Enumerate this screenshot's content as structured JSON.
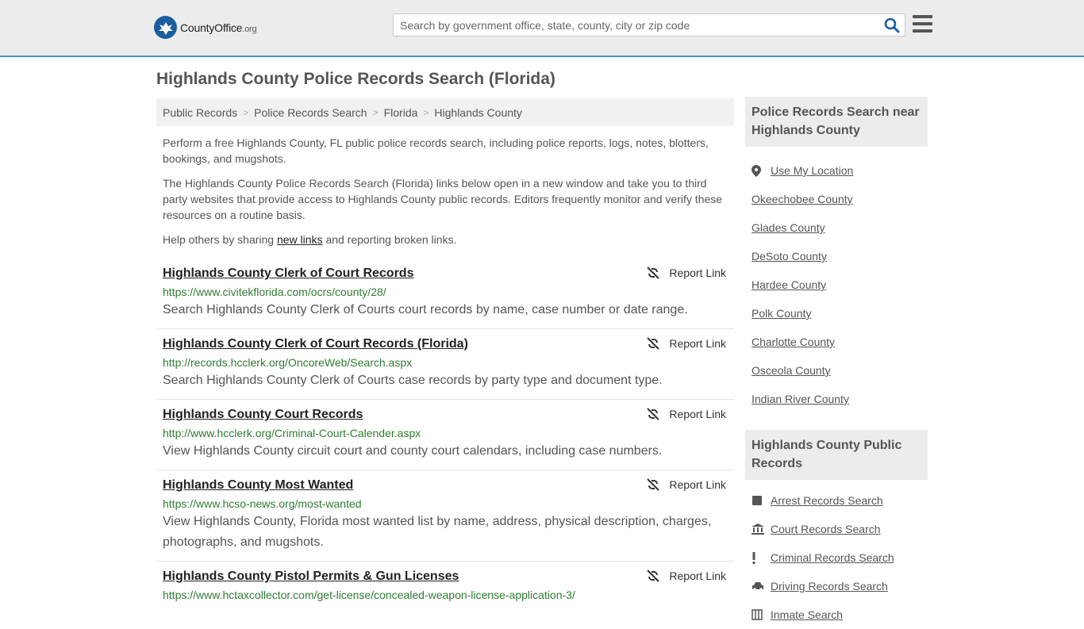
{
  "header": {
    "logo_name": "CountyOffice",
    "logo_suffix": ".org",
    "search_placeholder": "Search by government office, state, county, city or zip code"
  },
  "page_title": "Highlands County Police Records Search (Florida)",
  "breadcrumb": [
    "Public Records",
    "Police Records Search",
    "Florida",
    "Highlands County"
  ],
  "intro": {
    "p1": "Perform a free Highlands County, FL public police records search, including police reports, logs, notes, blotters, bookings, and mugshots.",
    "p2": "The Highlands County Police Records Search (Florida) links below open in a new window and take you to third party websites that provide access to Highlands County public records. Editors frequently monitor and verify these resources on a routine basis.",
    "p3_before": "Help others by sharing ",
    "p3_link": "new links",
    "p3_after": " and reporting broken links."
  },
  "report_label": "Report Link",
  "results": [
    {
      "title": "Highlands County Clerk of Court Records",
      "url": "https://www.civitekflorida.com/ocrs/county/28/",
      "desc": "Search Highlands County Clerk of Courts court records by name, case number or date range."
    },
    {
      "title": "Highlands County Clerk of Court Records (Florida)",
      "url": "http://records.hcclerk.org/OncoreWeb/Search.aspx",
      "desc": "Search Highlands County Clerk of Courts case records by party type and document type."
    },
    {
      "title": "Highlands County Court Records",
      "url": "http://www.hcclerk.org/Criminal-Court-Calender.aspx",
      "desc": "View Highlands County circuit court and county court calendars, including case numbers."
    },
    {
      "title": "Highlands County Most Wanted",
      "url": "https://www.hcso-news.org/most-wanted",
      "desc": "View Highlands County, Florida most wanted list by name, address, physical description, charges, photographs, and mugshots."
    },
    {
      "title": "Highlands County Pistol Permits & Gun Licenses",
      "url": "https://www.hctaxcollector.com/get-license/concealed-weapon-license-application-3/",
      "desc": ""
    }
  ],
  "sidebar": {
    "nearby_heading": "Police Records Search near Highlands County",
    "use_location": "Use My Location",
    "nearby": [
      "Okeechobee County",
      "Glades County",
      "DeSoto County",
      "Hardee County",
      "Polk County",
      "Charlotte County",
      "Osceola County",
      "Indian River County"
    ],
    "public_heading": "Highlands County Public Records",
    "public": [
      {
        "label": "Arrest Records Search",
        "icon": "arrest-icon"
      },
      {
        "label": "Court Records Search",
        "icon": "courthouse-icon"
      },
      {
        "label": "Criminal Records Search",
        "icon": "exclamation-icon"
      },
      {
        "label": "Driving Records Search",
        "icon": "car-icon"
      },
      {
        "label": "Inmate Search",
        "icon": "inmate-icon"
      }
    ]
  },
  "colors": {
    "accent": "#4a90c6",
    "url_green": "#2e7d32",
    "logo_blue": "#1a5e9e"
  }
}
